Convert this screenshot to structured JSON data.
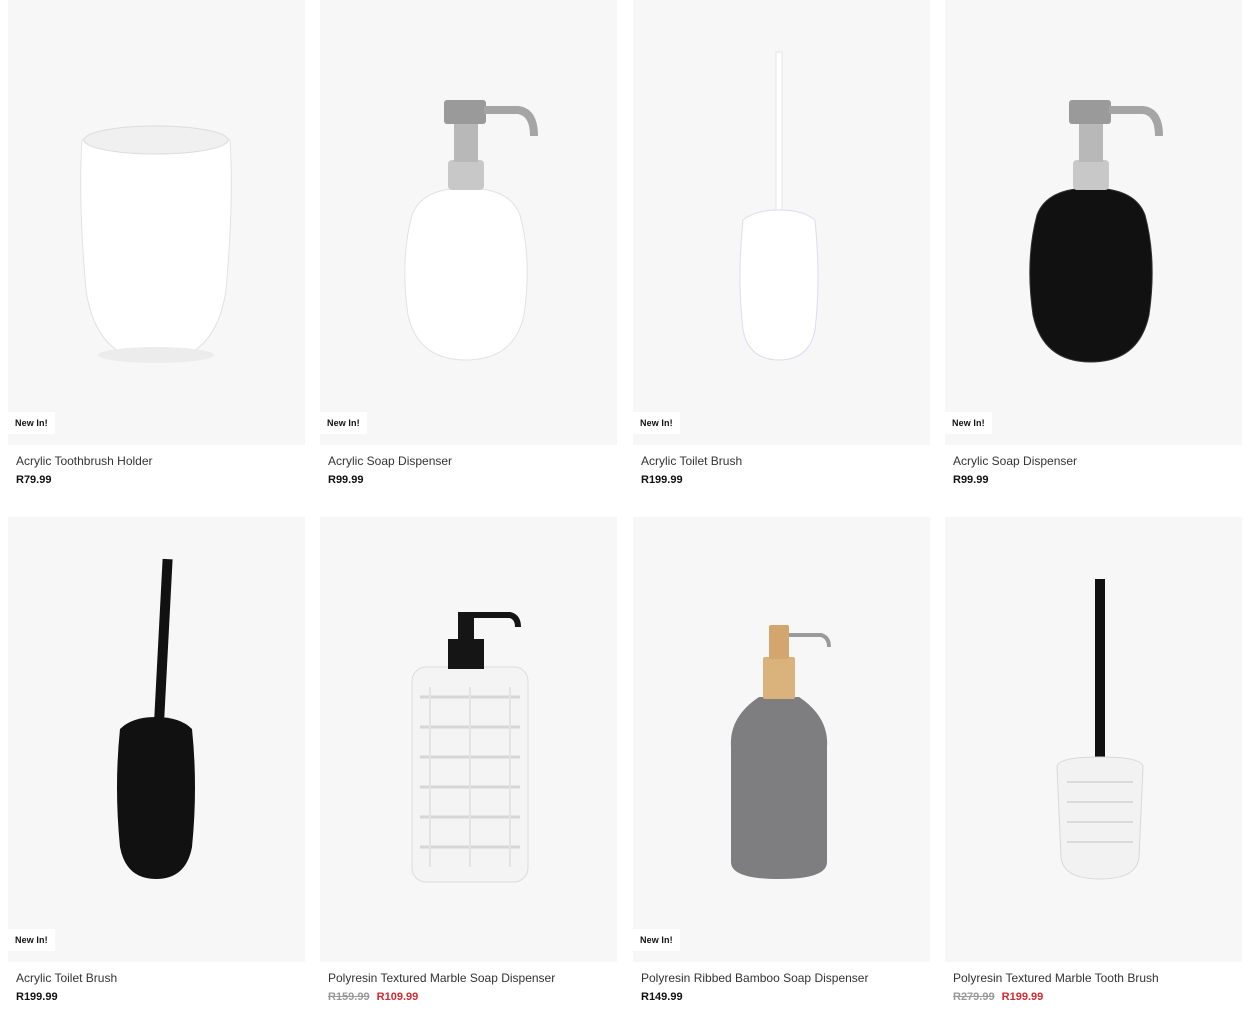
{
  "products": [
    {
      "title": "Acrylic Toothbrush Holder",
      "badge": "New In!",
      "price": "R79.99",
      "image_icon": "white-toothbrush-holder-icon"
    },
    {
      "title": "Acrylic Soap Dispenser",
      "badge": "New In!",
      "price": "R99.99",
      "image_icon": "white-soap-dispenser-icon"
    },
    {
      "title": "Acrylic Toilet Brush",
      "badge": "New In!",
      "price": "R199.99",
      "image_icon": "white-toilet-brush-icon"
    },
    {
      "title": "Acrylic Soap Dispenser",
      "badge": "New In!",
      "price": "R99.99",
      "image_icon": "black-soap-dispenser-icon"
    },
    {
      "title": "Acrylic Toilet Brush",
      "badge": "New In!",
      "price": "R199.99",
      "image_icon": "black-toilet-brush-icon"
    },
    {
      "title": "Polyresin Textured Marble Soap Dispenser",
      "badge": "",
      "price_old": "R159.99",
      "price_sale": "R109.99",
      "image_icon": "marble-soap-dispenser-icon"
    },
    {
      "title": "Polyresin Ribbed Bamboo Soap Dispenser",
      "badge": "New In!",
      "price": "R149.99",
      "image_icon": "bamboo-soap-dispenser-icon"
    },
    {
      "title": "Polyresin Textured Marble Tooth Brush",
      "badge": "",
      "price_old": "R279.99",
      "price_sale": "R199.99",
      "image_icon": "marble-toilet-brush-icon"
    }
  ],
  "colors": {
    "sale": "#d12a32",
    "image_bg": "#f7f7f7",
    "old_price": "#999999"
  }
}
